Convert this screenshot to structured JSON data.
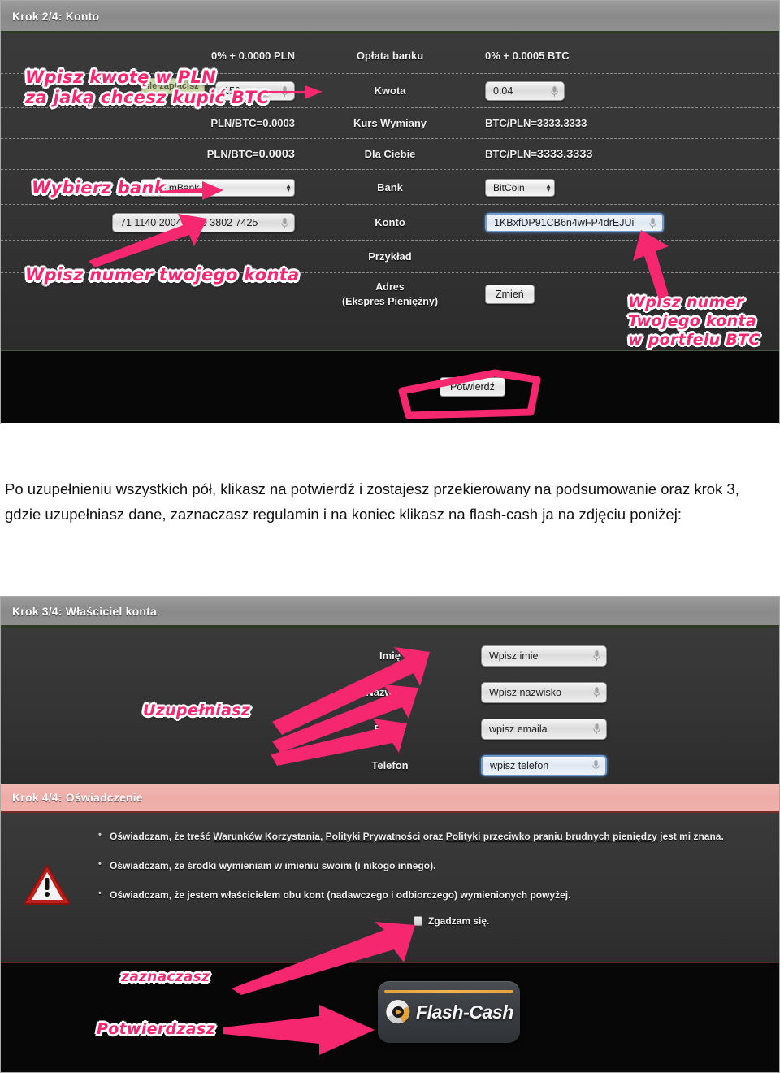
{
  "shot1": {
    "header": "Krok 2/4: Konto",
    "tooltip": "Ile zapłacisz",
    "rows": [
      {
        "left": "0% + 0.0000 PLN",
        "center": "Opłata banku",
        "right": "0% + 0.0005 BTC"
      },
      {
        "left_field": "150",
        "center": "Kwota",
        "right_field": "0.04"
      },
      {
        "left": "PLN/BTC=0.0003",
        "center": "Kurs Wymiany",
        "right": "BTC/PLN=3333.3333"
      },
      {
        "left": "PLN/BTC=",
        "left_bold": "0.0003",
        "center": "Dla Ciebie",
        "right": "BTC/PLN=",
        "right_bold": "3333.3333"
      },
      {
        "left_select": "PL - mBank",
        "center": "Bank",
        "right_select": "BitCoin"
      },
      {
        "left_field": "71 1140 2004 0000 3802 7425",
        "center": "Konto",
        "right_field": "1KBxfDP91CB6n4wFP4drEJUi"
      },
      {
        "center": "Przykład"
      },
      {
        "center": "Adres",
        "center2": "(Ekspres Pieniężny)",
        "right_button": "Zmień"
      }
    ],
    "confirm_button": "Potwierdź",
    "annotations": [
      "Wpisz kwotę w PLN\nza jaką chcesz kupić BTC",
      "Wybierz bank",
      "Wpisz numer twojego konta",
      "Wpisz numer\nTwojego konta\nw portfelu BTC"
    ]
  },
  "paragraph": "Po uzupełnieniu wszystkich pół, klikasz na potwierdź i zostajesz przekierowany na podsumowanie oraz krok 3, gdzie uzupełniasz dane, zaznaczasz regulamin i na koniec klikasz na flash-cash ja na zdjęciu poniżej:",
  "shot2": {
    "header3": "Krok 3/4: Właściciel konta",
    "owner_rows": [
      {
        "label": "Imię",
        "placeholder": "Wpisz imie"
      },
      {
        "label": "Nazwisko",
        "placeholder": "Wpisz nazwisko"
      },
      {
        "label": "E-mail",
        "placeholder": "wpisz emaila"
      },
      {
        "label": "Telefon",
        "placeholder": "wpisz telefon"
      }
    ],
    "owner_annotation": "Uzupełniasz",
    "header4": "Krok 4/4: Oświadczenie",
    "statements": [
      {
        "parts": [
          {
            "t": "Oświadczam, że treść ",
            "u": false
          },
          {
            "t": "Warunków Korzystania",
            "u": true
          },
          {
            "t": ", ",
            "u": false
          },
          {
            "t": "Polityki Prywatności",
            "u": true
          },
          {
            "t": " oraz ",
            "u": false
          },
          {
            "t": "Polityki przeciwko praniu brudnych pieniędzy",
            "u": true
          },
          {
            "t": " jest mi znana.",
            "u": false
          }
        ]
      },
      {
        "parts": [
          {
            "t": "Oświadczam, że środki wymieniam w imieniu swoim (i nikogo innego).",
            "u": false
          }
        ]
      },
      {
        "parts": [
          {
            "t": "Oświadczam, że jestem właścicielem obu kont (nadawczego i odbiorczego) wymienionych powyżej.",
            "u": false
          }
        ]
      }
    ],
    "agree_label": "Zgadzam się.",
    "flash_cash_label": "Flash-Cash",
    "annotation_check": "zaznaczasz",
    "annotation_confirm": "Potwierdzasz"
  },
  "colors": {
    "accent_pink": "#f4276f",
    "header_gray": "#8d8d8d",
    "header_pink": "#eeaba6",
    "panel_dark": "#343434",
    "panel_black": "#070707",
    "brand_orange": "#e2a23c"
  }
}
